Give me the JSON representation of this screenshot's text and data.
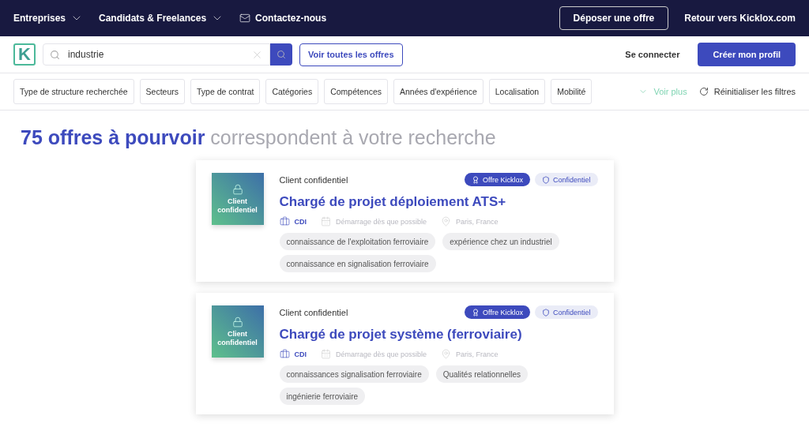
{
  "top_nav": {
    "menus": [
      {
        "label": "Entreprises",
        "kind": "dropdown"
      },
      {
        "label": "Candidats & Freelances",
        "kind": "dropdown"
      },
      {
        "label": "Contactez-nous",
        "kind": "mail"
      }
    ],
    "post_button": "Déposer une offre",
    "back_link": "Retour vers Kicklox.com"
  },
  "search_bar": {
    "logo": "K",
    "value": "industrie",
    "all_offers_button": "Voir toutes les offres",
    "login_link": "Se connecter",
    "signup_button": "Créer mon profil"
  },
  "filters": {
    "items": [
      "Type de structure recherchée",
      "Secteurs",
      "Type de contrat",
      "Catégories",
      "Compétences",
      "Années d'expérience",
      "Localisation",
      "Mobilité"
    ],
    "more": "Voir plus",
    "reset": "Réinitialiser les filtres"
  },
  "results_heading": {
    "count": "75 offres à pourvoir",
    "rest": "correspondent à votre recherche"
  },
  "offers": [
    {
      "logo_text": "Client confidentiel",
      "company": "Client confidentiel",
      "badges": [
        {
          "label": "Offre Kicklox",
          "kind": "kicklox"
        },
        {
          "label": "Confidentiel",
          "kind": "confidential"
        }
      ],
      "title": "Chargé de projet déploiement ATS+",
      "contract": "CDI",
      "start": "Démarrage dès que possible",
      "location": "Paris, France",
      "tags": [
        "connaissance de l'exploitation ferroviaire",
        "expérience chez un industriel",
        "connaissance en signalisation ferroviaire"
      ]
    },
    {
      "logo_text": "Client confidentiel",
      "company": "Client confidentiel",
      "badges": [
        {
          "label": "Offre Kicklox",
          "kind": "kicklox"
        },
        {
          "label": "Confidentiel",
          "kind": "confidential"
        }
      ],
      "title": "Chargé de projet système (ferroviaire)",
      "contract": "CDI",
      "start": "Démarrage dès que possible",
      "location": "Paris, France",
      "tags": [
        "connaissances signalisation ferroviaire",
        "Qualités relationnelles",
        "ingénierie ferroviaire"
      ]
    }
  ]
}
